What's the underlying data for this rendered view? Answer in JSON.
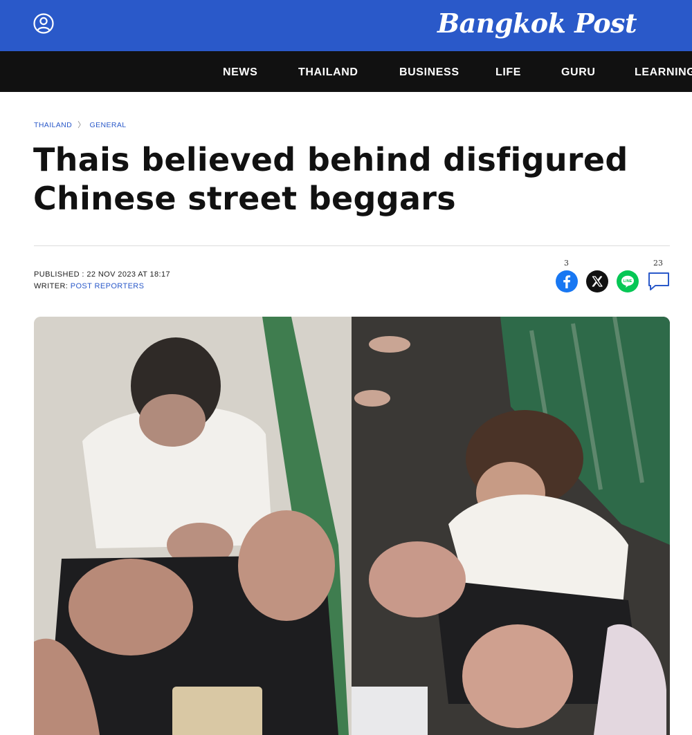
{
  "header": {
    "logo_text": "Bangkok Post",
    "brand_color": "#2a59c9",
    "user_icon": "user-circle-icon"
  },
  "nav": {
    "items": [
      "NEWS",
      "THAILAND",
      "BUSINESS",
      "LIFE",
      "GURU",
      "LEARNING"
    ]
  },
  "breadcrumb": {
    "section": "THAILAND",
    "subsection": "GENERAL"
  },
  "article": {
    "headline": "Thais believed behind disfigured Chinese street beggars",
    "published_label": "PUBLISHED : 22 NOV 2023 AT 18:17",
    "writer_label": "WRITER:",
    "writer_name": "POST REPORTERS"
  },
  "share": {
    "facebook_count": "3",
    "comment_count": "23",
    "icons": [
      "facebook-icon",
      "x-icon",
      "line-icon",
      "comment-icon"
    ]
  }
}
